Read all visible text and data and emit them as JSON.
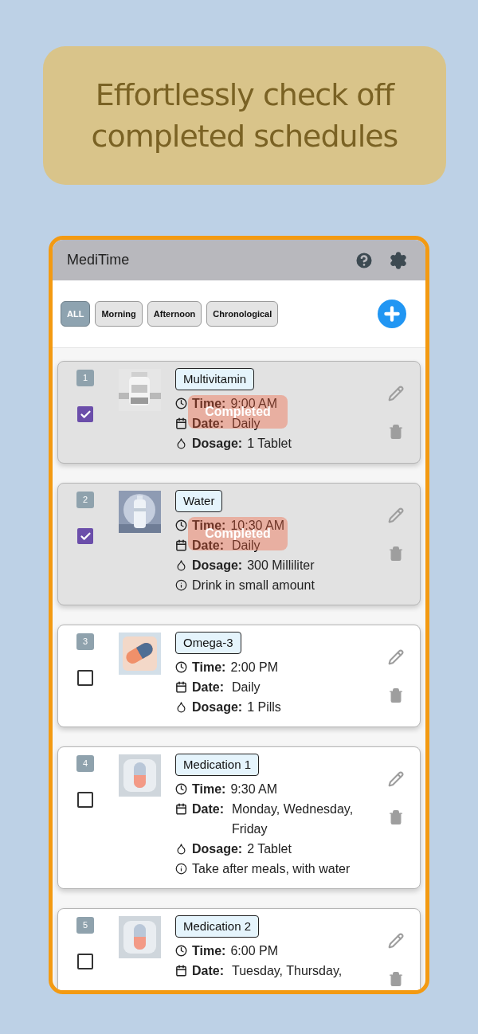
{
  "banner": {
    "text": "Effortlessly check off completed schedules"
  },
  "app": {
    "title": "MediTime"
  },
  "filters": [
    {
      "label": "ALL",
      "selected": true
    },
    {
      "label": "Morning",
      "selected": false
    },
    {
      "label": "Afternoon",
      "selected": false
    },
    {
      "label": "Chronological",
      "selected": false
    }
  ],
  "medications": [
    {
      "number": "1",
      "name": "Multivitamin",
      "checked": true,
      "badge": "Completed",
      "details": [
        {
          "kind": "time",
          "label": "Time:",
          "value": "9:00 AM"
        },
        {
          "kind": "date",
          "label": "Date:",
          "value": "Daily"
        },
        {
          "kind": "dosage",
          "label": "Dosage:",
          "value": "1 Tablet"
        }
      ]
    },
    {
      "number": "2",
      "name": "Water",
      "checked": true,
      "badge": "Completed",
      "details": [
        {
          "kind": "time",
          "label": "Time:",
          "value": "10:30 AM"
        },
        {
          "kind": "date",
          "label": "Date:",
          "value": "Daily"
        },
        {
          "kind": "dosage",
          "label": "Dosage:",
          "value": "300 Milliliter"
        },
        {
          "kind": "note",
          "value": "Drink in small amount"
        }
      ]
    },
    {
      "number": "3",
      "name": "Omega-3",
      "checked": false,
      "details": [
        {
          "kind": "time",
          "label": "Time:",
          "value": "2:00 PM"
        },
        {
          "kind": "date",
          "label": "Date:",
          "value": "Daily"
        },
        {
          "kind": "dosage",
          "label": "Dosage:",
          "value": "1 Pills"
        }
      ]
    },
    {
      "number": "4",
      "name": "Medication 1",
      "checked": false,
      "details": [
        {
          "kind": "time",
          "label": "Time:",
          "value": "9:30 AM"
        },
        {
          "kind": "date",
          "label": "Date:",
          "value": "Monday, Wednesday, Friday"
        },
        {
          "kind": "dosage",
          "label": "Dosage:",
          "value": "2 Tablet"
        },
        {
          "kind": "note",
          "value": "Take after meals, with water"
        }
      ]
    },
    {
      "number": "5",
      "name": "Medication 2",
      "checked": false,
      "details": [
        {
          "kind": "time",
          "label": "Time:",
          "value": "6:00 PM"
        },
        {
          "kind": "date",
          "label": "Date:",
          "value": "Tuesday, Thursday,"
        }
      ]
    }
  ]
}
